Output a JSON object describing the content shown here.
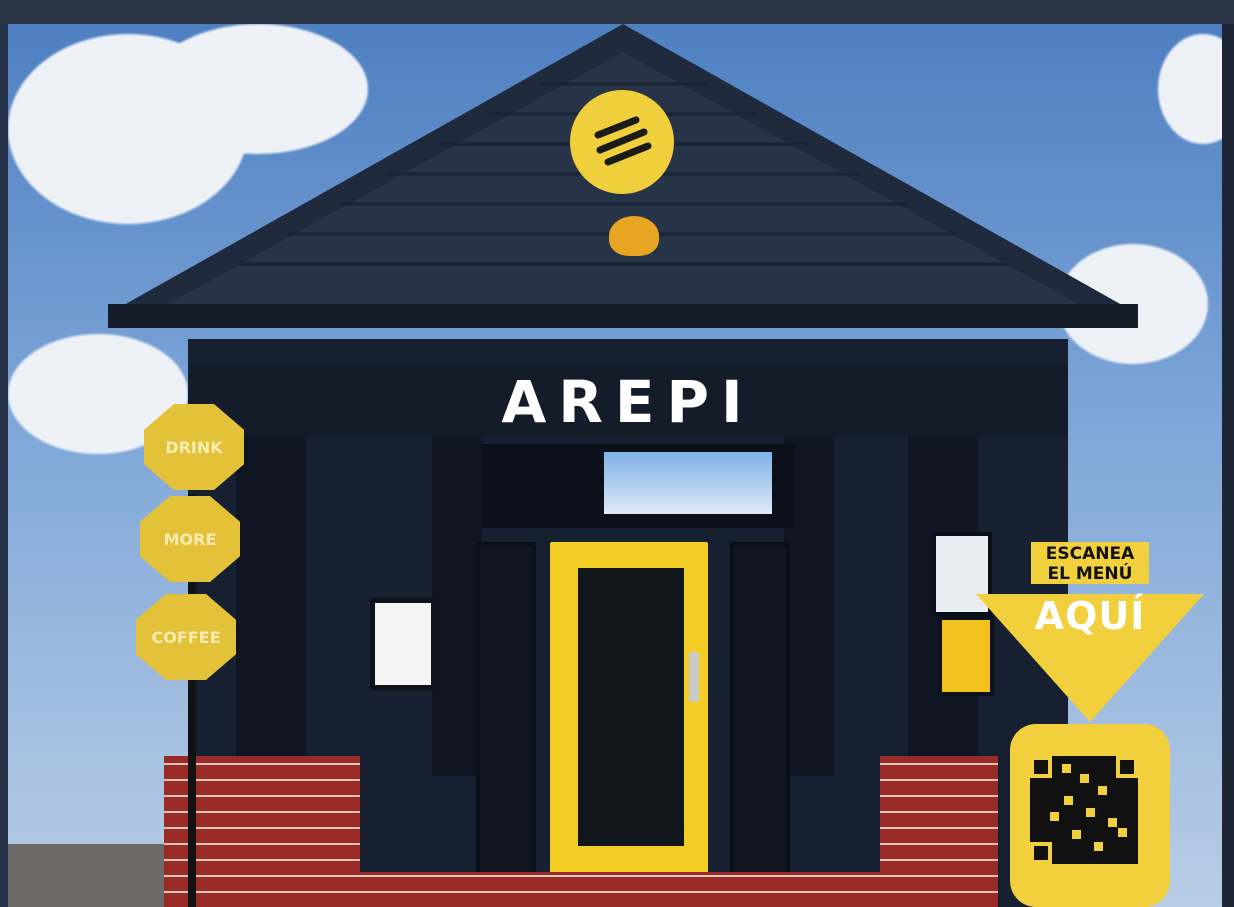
{
  "storefront": {
    "sign_text": "AREPI"
  },
  "street_signs": [
    {
      "label": "DRINK"
    },
    {
      "label": "MORE"
    },
    {
      "label": "COFFEE"
    }
  ],
  "scan_callout": {
    "line1": "ESCANEA",
    "line2": "EL MENÚ",
    "aqui": "AQUÍ"
  },
  "colors": {
    "brand_yellow": "#f1cf3d",
    "building_navy": "#172030",
    "sky_blue": "#4e7fc1"
  }
}
